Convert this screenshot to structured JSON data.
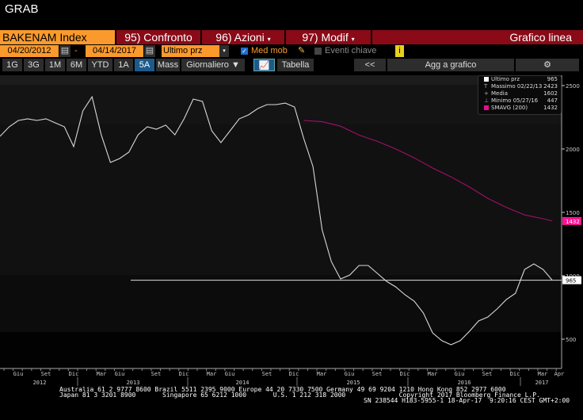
{
  "window": {
    "title": "GRAB"
  },
  "toolbar": {
    "security": "BAKENAM Index",
    "compare": "95) Confronto",
    "actions": "96) Azioni",
    "edit": "97) Modif",
    "chart_type": "Grafico linea"
  },
  "controls": {
    "start_date": "04/20/2012",
    "dash": "-",
    "end_date": "04/14/2017",
    "field": "Ultimo prz",
    "moving_avg_label": "Med mob",
    "key_events_label": "Eventi chiave",
    "info": "i"
  },
  "periods": [
    "1G",
    "3G",
    "1M",
    "6M",
    "YTD",
    "1A",
    "5A",
    "Mass"
  ],
  "active_period": "5A",
  "frequency": "Giornaliero ▼",
  "table_label": "Tabella",
  "back_label": "<<",
  "add_label": "Agg a grafico",
  "settings_label": "⚙",
  "legend": [
    {
      "label": "Ultimo prz",
      "value": "965",
      "color": "#ffffff"
    },
    {
      "label": "Massimo 02/22/13",
      "value": "2423",
      "marker": "T"
    },
    {
      "label": "Media",
      "value": "1602",
      "marker": "+"
    },
    {
      "label": "Minimo 05/27/16",
      "value": "447",
      "marker": "⊥"
    },
    {
      "label": "SMAVG (200)",
      "value": "1432",
      "color": "#e0108a"
    }
  ],
  "colors": {
    "price": "#d8d8d8",
    "sma": "#a0106a",
    "sma_tag": "#ff1493",
    "accent": "#fb9a2c",
    "header_red": "#8a0a17"
  },
  "chart_data": {
    "type": "line",
    "yticks": [
      500,
      1000,
      1500,
      2000,
      2500
    ],
    "ylim": [
      0,
      2650
    ],
    "last_price_label": "965",
    "sma_label": "1432",
    "month_labels": [
      "Giu",
      "Set",
      "Dic",
      "Mar",
      "Giu",
      "Set",
      "Dic",
      "Mar",
      "Giu",
      "Set",
      "Dic",
      "Mar",
      "Giu",
      "Set",
      "Dic",
      "Mar",
      "Giu",
      "Set",
      "Dic",
      "Mar",
      "Apr"
    ],
    "year_labels": [
      "2012",
      "2013",
      "2014",
      "2015",
      "2016",
      "2017"
    ],
    "series": [
      {
        "name": "Ultimo prz",
        "x": [
          "2012-04",
          "2012-05",
          "2012-06",
          "2012-07",
          "2012-08",
          "2012-09",
          "2012-10",
          "2012-11",
          "2012-12",
          "2013-01",
          "2013-02",
          "2013-03",
          "2013-04",
          "2013-05",
          "2013-06",
          "2013-07",
          "2013-08",
          "2013-09",
          "2013-10",
          "2013-11",
          "2013-12",
          "2014-01",
          "2014-02",
          "2014-03",
          "2014-04",
          "2014-05",
          "2014-06",
          "2014-07",
          "2014-08",
          "2014-09",
          "2014-10",
          "2014-11",
          "2014-12",
          "2015-01",
          "2015-02",
          "2015-03",
          "2015-04",
          "2015-05",
          "2015-06",
          "2015-07",
          "2015-08",
          "2015-09",
          "2015-10",
          "2015-11",
          "2015-12",
          "2016-01",
          "2016-02",
          "2016-03",
          "2016-04",
          "2016-05",
          "2016-06",
          "2016-07",
          "2016-08",
          "2016-09",
          "2016-10",
          "2016-11",
          "2016-12",
          "2017-01",
          "2017-02",
          "2017-03",
          "2017-04"
        ],
        "values": [
          2100,
          2175,
          2225,
          2238,
          2225,
          2238,
          2206,
          2175,
          2019,
          2300,
          2412,
          2112,
          1894,
          1925,
          1975,
          2112,
          2175,
          2156,
          2188,
          2112,
          2238,
          2394,
          2375,
          2144,
          2050,
          2144,
          2238,
          2269,
          2319,
          2350,
          2350,
          2362,
          2331,
          2081,
          1862,
          1362,
          1112,
          975,
          1006,
          1081,
          1081,
          1019,
          956,
          912,
          850,
          800,
          706,
          550,
          488,
          456,
          488,
          562,
          644,
          675,
          738,
          812,
          862,
          1050,
          1094,
          1050,
          965
        ]
      },
      {
        "name": "SMAVG (200)",
        "x": [
          "2015-01",
          "2015-03",
          "2015-05",
          "2015-07",
          "2015-09",
          "2015-11",
          "2016-01",
          "2016-03",
          "2016-05",
          "2016-07",
          "2016-09",
          "2016-11",
          "2017-01",
          "2017-03",
          "2017-04"
        ],
        "values": [
          2225,
          2215,
          2180,
          2110,
          2060,
          2000,
          1930,
          1850,
          1780,
          1700,
          1610,
          1540,
          1480,
          1450,
          1432
        ]
      }
    ],
    "horizontal_line": 965
  },
  "footer": {
    "line1": "Australia 61 2 9777 8600 Brazil 5511 2395 9000 Europe 44 20 7330 7500 Germany 49 69 9204 1210 Hong Kong 852 2977 6000",
    "line2": "Japan 81 3 3201 8900       Singapore 65 6212 1000       U.S. 1 212 318 2000              Copyright 2017 Bloomberg Finance L.P.",
    "line3": "SN 238544 H183-5955-1 18-Apr-17  9:20:16 CEST GMT+2:00"
  }
}
